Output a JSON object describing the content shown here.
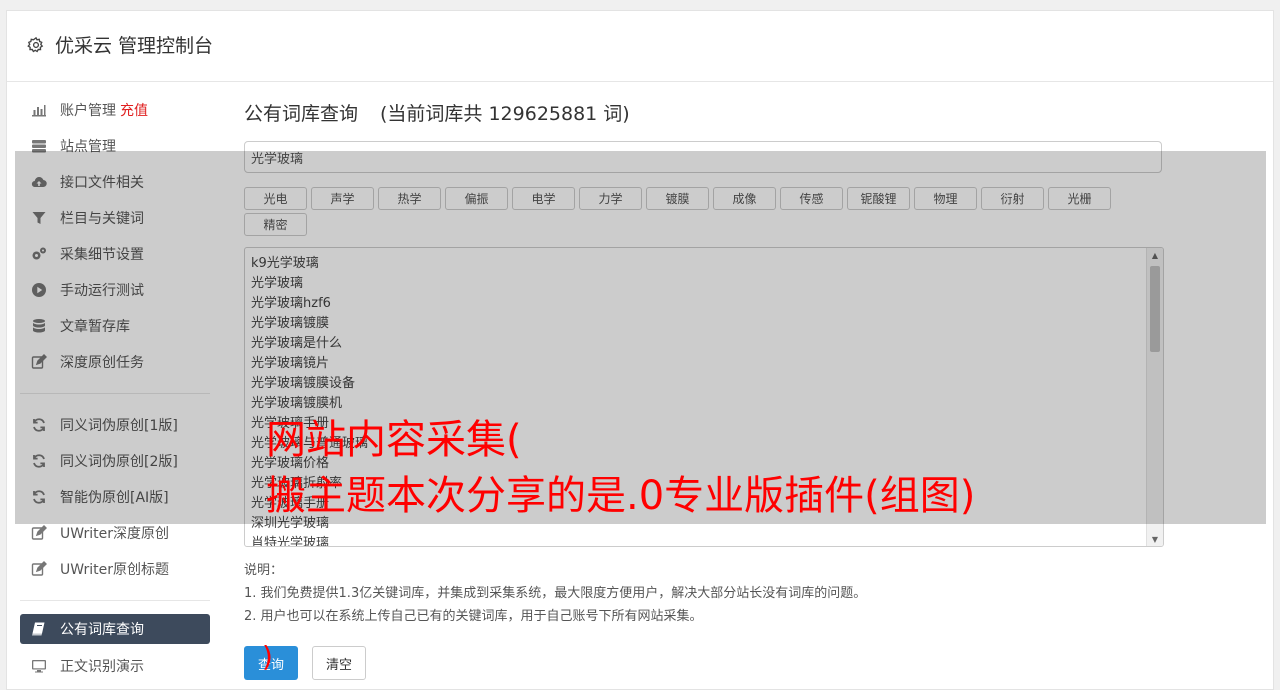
{
  "header": {
    "title": "优采云 管理控制台",
    "icon": "gear-icon"
  },
  "sidebar": {
    "groups": [
      [
        {
          "label": "账户管理",
          "badge": "充值",
          "icon": "bar-chart-icon"
        },
        {
          "label": "站点管理",
          "icon": "server-icon"
        },
        {
          "label": "接口文件相关",
          "icon": "cloud-upload-icon"
        },
        {
          "label": "栏目与关键词",
          "icon": "filter-icon"
        },
        {
          "label": "采集细节设置",
          "icon": "gears-icon"
        },
        {
          "label": "手动运行测试",
          "icon": "play-circle-icon"
        },
        {
          "label": "文章暂存库",
          "icon": "database-icon"
        },
        {
          "label": "深度原创任务",
          "icon": "edit-icon"
        }
      ],
      [
        {
          "label": "同义词伪原创[1版]",
          "icon": "refresh-icon"
        },
        {
          "label": "同义词伪原创[2版]",
          "icon": "refresh-icon"
        },
        {
          "label": "智能伪原创[AI版]",
          "icon": "refresh-icon"
        },
        {
          "label": "UWriter深度原创",
          "icon": "edit-icon"
        },
        {
          "label": "UWriter原创标题",
          "icon": "edit-icon"
        }
      ],
      [
        {
          "label": "公有词库查询",
          "icon": "book-icon",
          "active": true
        },
        {
          "label": "正文识别演示",
          "icon": "monitor-icon"
        }
      ]
    ]
  },
  "main": {
    "title": "公有词库查询",
    "count": "(当前词库共 129625881 词)",
    "search_value": "光学玻璃",
    "tags": [
      "光电",
      "声学",
      "热学",
      "偏振",
      "电学",
      "力学",
      "镀膜",
      "成像",
      "传感",
      "铌酸锂",
      "物理",
      "衍射",
      "光栅",
      "精密"
    ],
    "results": [
      "k9光学玻璃",
      "光学玻璃",
      "光学玻璃hzf6",
      "光学玻璃镀膜",
      "光学玻璃是什么",
      "光学玻璃镜片",
      "光学玻璃镀膜设备",
      "光学玻璃镀膜机",
      "光学玻璃手册",
      "光学玻璃与普通玻璃",
      "光学玻璃价格",
      "光学玻璃折射率",
      "光学玻璃手册",
      "深圳光学玻璃",
      "肖特光学玻璃"
    ],
    "notes_title": "说明：",
    "notes": [
      "1. 我们免费提供1.3亿关键词库，并集成到采集系统，最大限度方便用户，解决大部分站长没有词库的问题。",
      "2. 用户也可以在系统上传自己已有的关键词库，用于自己账号下所有网站采集。"
    ],
    "query_button": "查询",
    "clear_button": "清空"
  },
  "watermark": {
    "line1": "网站内容采集(",
    "line2": "搬主题本次分享的是.0专业版插件(组图)",
    "tail": ")"
  }
}
